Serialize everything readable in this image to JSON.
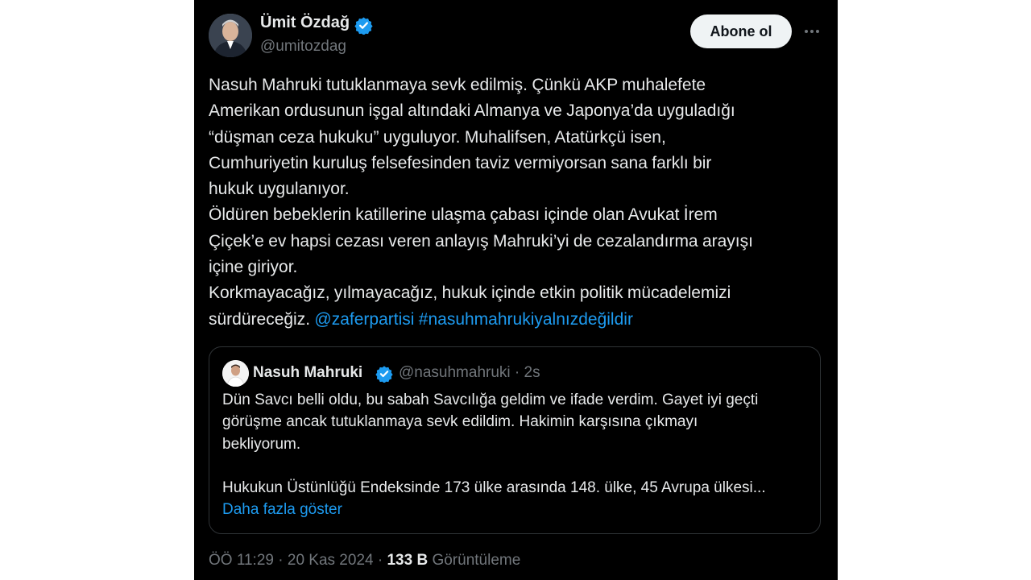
{
  "author": {
    "name": "Ümit Özdağ",
    "handle": "@umitozdag",
    "verified": true
  },
  "follow_button_label": "Abone ol",
  "more_icon": "ellipsis-horizontal-icon",
  "tweet": {
    "text_main": "Nasuh Mahruki tutuklanmaya sevk edilmiş. Çünkü AKP muhalefete\nAmerikan ordusunun işgal altındaki Almanya ve Japonya’da uyguladığı\n“düşman ceza hukuku” uyguluyor. Muhalifsen, Atatürkçü isen,\nCumhuriyetin kuruluş felsefesinden taviz vermiyorsan sana farklı bir\nhukuk uygulanıyor.\nÖldüren bebeklerin katillerine ulaşma çabası içinde olan Avukat İrem\nÇiçek’e ev hapsi cezası veren anlayış Mahruki’yi de cezalandırma arayışı\niçine giriyor.\nKorkmayacağız, yılmayacağız, hukuk içinde etkin politik mücadelemizi\nsürdüreceğiz. ",
    "mention": "@zaferpartisi",
    "hashtag": "#nasuhmahrukiyalnızdeğildir"
  },
  "quote": {
    "name": "Nasuh Mahruki",
    "verified": true,
    "handle": "@nasuhmahruki",
    "separator": "·",
    "time": "2s",
    "text": "Dün Savcı belli oldu, bu sabah Savcılığa geldim ve ifade verdim. Gayet iyi geçti\ngörüşme ancak tutuklanmaya sevk edildim. Hakimin karşısına çıkmayı\nbekliyorum.",
    "text_truncated": "Hukukun Üstünlüğü Endeksinde 173 ülke arasında 148. ülke, 45 Avrupa ülkesi...",
    "show_more_label": "Daha fazla göster"
  },
  "meta": {
    "time": "ÖÖ 11:29",
    "sep1": "·",
    "date": "20 Kas 2024",
    "sep2": "·",
    "views_count": "133 B",
    "views_label": "Görüntüleme"
  },
  "colors": {
    "background": "#000000",
    "text": "#e7e9ea",
    "secondary_text": "#71767b",
    "link": "#1d9bf0",
    "verified_badge": "#1d9bf0",
    "border": "#2f3336"
  }
}
